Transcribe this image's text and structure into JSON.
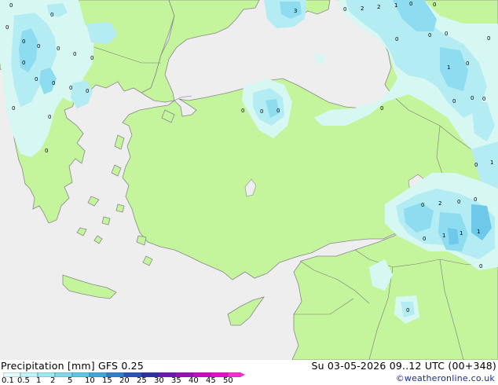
{
  "footer": {
    "title_left": "Precipitation [mm]  GFS 0.25",
    "title_right": "Su 03-05-2026 09..12 UTC (00+348)",
    "credit": "©weatheronline.co.uk"
  },
  "legend": {
    "values": [
      "0.1",
      "0.5",
      "1",
      "2",
      "5",
      "10",
      "15",
      "20",
      "25",
      "30",
      "35",
      "40",
      "45",
      "50"
    ],
    "colors": [
      "#e0fbfc",
      "#bff3f8",
      "#9fe8f2",
      "#7fd8ec",
      "#5fc6e4",
      "#3fa8d8",
      "#2f80c8",
      "#2a55b6",
      "#2a30a0",
      "#6a18b0",
      "#9a10b8",
      "#c80cc0",
      "#e010c8",
      "#f030d0"
    ]
  },
  "colors": {
    "sea": "#eeeeee",
    "land": "#c4f59c",
    "rain_light": "#d7f7f2",
    "rain_medium": "#b4ecf4",
    "rain_heavy": "#8edcef",
    "rain_strong": "#6ec8ea"
  },
  "precip_labels": [
    {
      "text": "0"
    },
    {
      "text": "3"
    },
    {
      "text": "0"
    },
    {
      "text": "2"
    },
    {
      "text": "2"
    },
    {
      "text": "1"
    },
    {
      "text": "0"
    },
    {
      "text": "0"
    },
    {
      "text": "0"
    },
    {
      "text": "0"
    },
    {
      "text": "0"
    },
    {
      "text": "0"
    },
    {
      "text": "0"
    },
    {
      "text": "0"
    },
    {
      "text": "0"
    },
    {
      "text": "0"
    },
    {
      "text": "0"
    },
    {
      "text": "0"
    },
    {
      "text": "0"
    },
    {
      "text": "0"
    },
    {
      "text": "0"
    },
    {
      "text": "0"
    },
    {
      "text": "0"
    },
    {
      "text": "0"
    },
    {
      "text": "0"
    },
    {
      "text": "0"
    },
    {
      "text": "0"
    },
    {
      "text": "0"
    },
    {
      "text": "1"
    },
    {
      "text": "0"
    },
    {
      "text": "0"
    },
    {
      "text": "0"
    },
    {
      "text": "0"
    },
    {
      "text": "0"
    },
    {
      "text": "1"
    },
    {
      "text": "0"
    },
    {
      "text": "2"
    },
    {
      "text": "0"
    },
    {
      "text": "0"
    },
    {
      "text": "1"
    },
    {
      "text": "1"
    },
    {
      "text": "1"
    },
    {
      "text": "0"
    },
    {
      "text": "0"
    },
    {
      "text": "0"
    }
  ]
}
